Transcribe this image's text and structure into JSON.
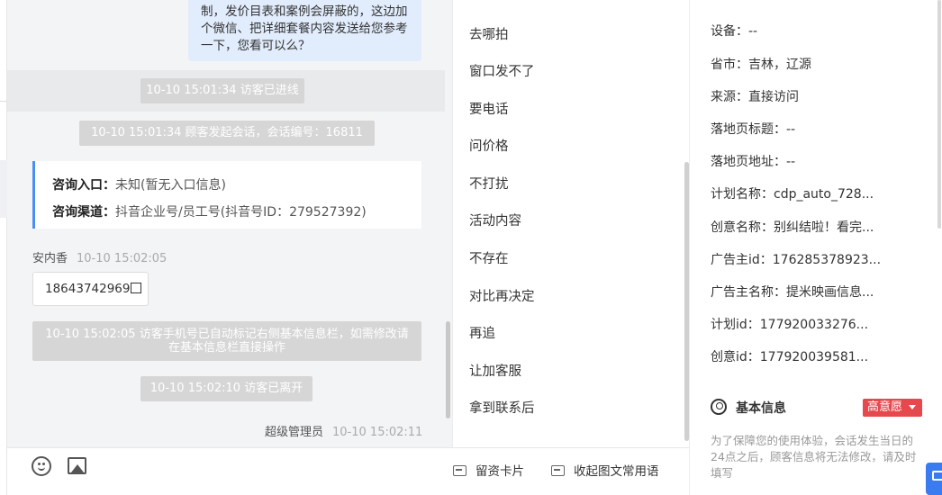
{
  "chat": {
    "agent_message": "制，发价目表和案例会屏蔽的，这边加个微信、把详细套餐内容发送给您参考一下，您看可以么？",
    "system_entered": "10-10 15:01:34 访客已进线",
    "system_session": "10-10 15:01:34 顾客发起会话，会话编号：16811",
    "entry_label": "咨询入口：",
    "entry_value": "未知(暂无入口信息)",
    "channel_label": "咨询渠道：",
    "channel_value": "抖音企业号/员工号(抖音号ID：279527392)",
    "visitor_name": "安内香",
    "visitor_time": "10-10 15:02:05",
    "visitor_phone": "18643742969",
    "system_marked": "10-10 15:02:05 访客手机号已自动标记右侧基本信息栏，如需修改请在基本信息栏直接操作",
    "system_left": "10-10 15:02:10 访客已离开",
    "admin_name": "超级管理员",
    "admin_time": "10-10 15:02:11"
  },
  "toolbar": {
    "emoji_icon": "emoji-icon",
    "image_icon": "image-icon",
    "lead_card_label": "留资卡片",
    "collapse_label": "收起图文常用语"
  },
  "quick_replies": [
    "去哪拍",
    "窗口发不了",
    "要电话",
    "问价格",
    "不打扰",
    "活动内容",
    "不存在",
    "对比再决定",
    "再追",
    "让加客服",
    "拿到联系后"
  ],
  "info": {
    "rows": [
      "设备：--",
      "省市：吉林，辽源",
      "来源：直接访问",
      "落地页标题：--",
      "落地页地址：--",
      "计划名称：cdp_auto_728...",
      "创意名称：别纠结啦！看完...",
      "广告主id：176285378923...",
      "广告主名称：提米映画信息...",
      "计划id：177920033276...",
      "创意id：177920039581..."
    ],
    "section_title": "基本信息",
    "intent_label": "高意愿",
    "notice": "为了保障您的使用体验，会话发生当日的24点之后，顾客信息将无法修改，请及时填写"
  },
  "colors": {
    "accent": "#4a8ef5",
    "intent": "#e5484d",
    "bubble": "#e1ecfc"
  }
}
